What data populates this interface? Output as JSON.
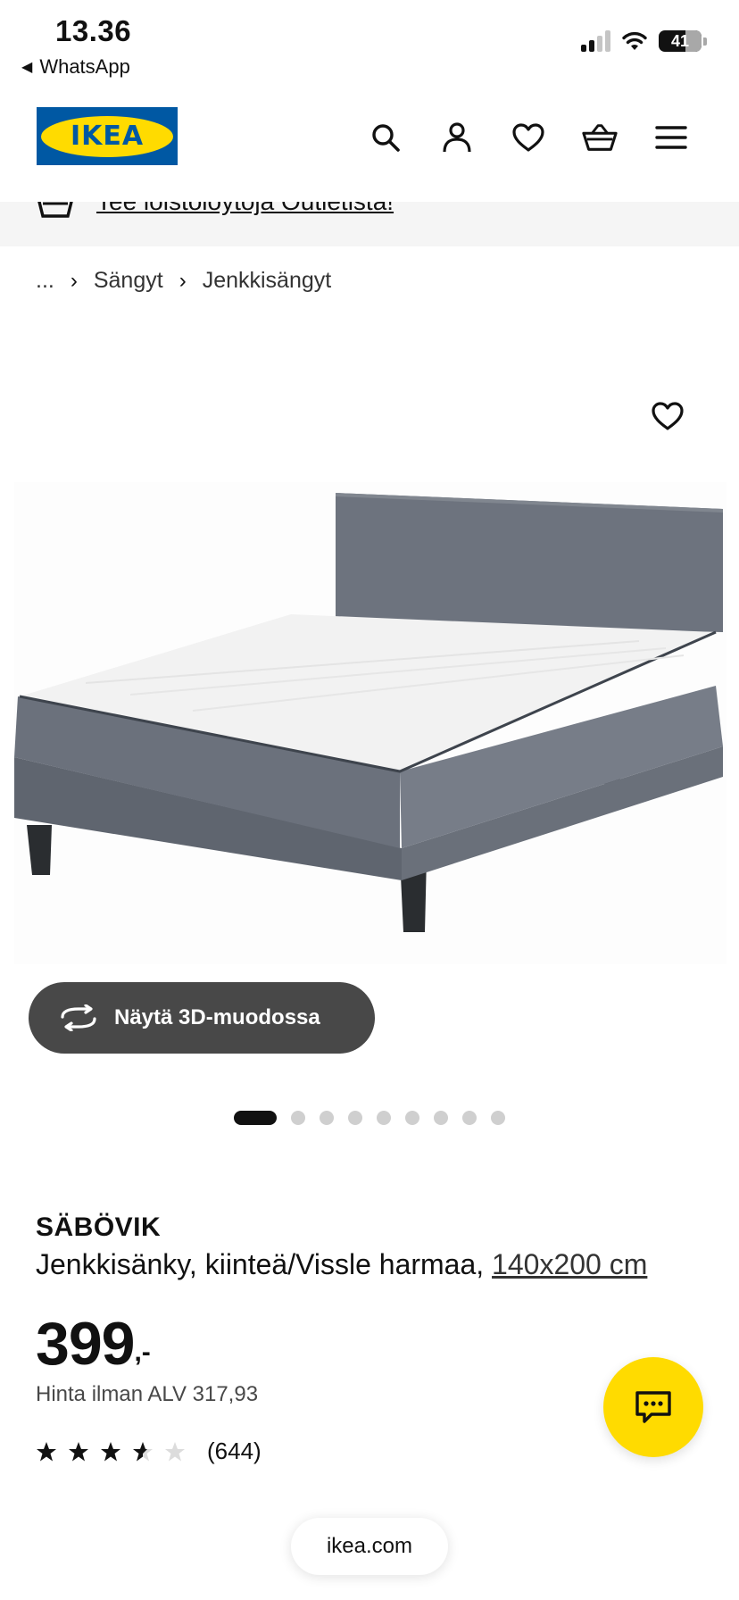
{
  "status_bar": {
    "time": "13.36",
    "back_app": "WhatsApp",
    "battery": "41"
  },
  "header": {
    "logo_text": "IKEA",
    "icons": [
      "search-icon",
      "user-icon",
      "heart-icon",
      "basket-icon",
      "menu-icon"
    ]
  },
  "promo": {
    "text": "Tee loistolöytöjä Outletista!"
  },
  "breadcrumb": {
    "ellipsis": "...",
    "items": [
      "Sängyt",
      "Jenkkisängyt"
    ]
  },
  "gallery": {
    "view_3d_label": "Näytä 3D-muodossa",
    "dot_count": 9,
    "active_index": 0
  },
  "product": {
    "name": "SÄBÖVIK",
    "description": "Jenkkisänky, kiinteä/Vissle harmaa,",
    "size_link": "140x200 cm",
    "price_integer": "399",
    "price_suffix": ",-",
    "vat_text": "Hinta ilman ALV 317,93",
    "rating_value": 3.5,
    "rating_max": 5,
    "review_count": "(644)"
  },
  "browser": {
    "url": "ikea.com"
  },
  "colors": {
    "brand_blue": "#0058a3",
    "brand_yellow": "#ffdb00",
    "button_dark": "#484848"
  }
}
